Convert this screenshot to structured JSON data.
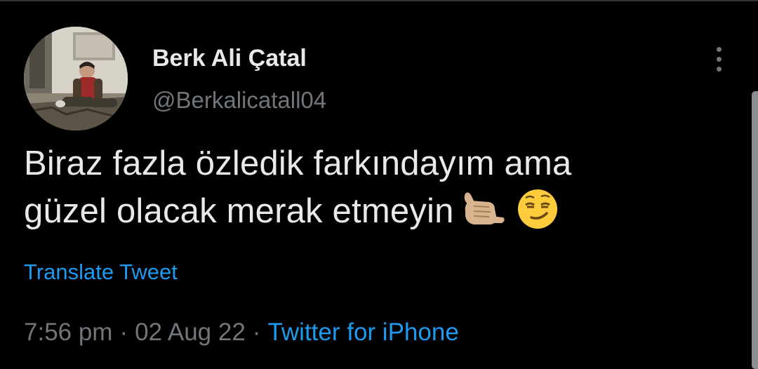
{
  "author": {
    "display_name": "Berk Ali Çatal",
    "handle": "@Berkalicatall04"
  },
  "tweet": {
    "text_line_1": "Biraz fazla özledik farkındayım ama",
    "text_line_2": "güzel olacak merak etmeyin",
    "emojis": [
      "call-me-hand-emoji",
      "smirking-face-emoji"
    ]
  },
  "actions": {
    "translate_label": "Translate Tweet"
  },
  "meta": {
    "time": "7:56 pm",
    "separator": "·",
    "date": "02 Aug 22",
    "source": "Twitter for iPhone"
  },
  "colors": {
    "background": "#000000",
    "primary_text": "#e7e9ea",
    "secondary_text": "#71767b",
    "link": "#1d9bf0"
  }
}
